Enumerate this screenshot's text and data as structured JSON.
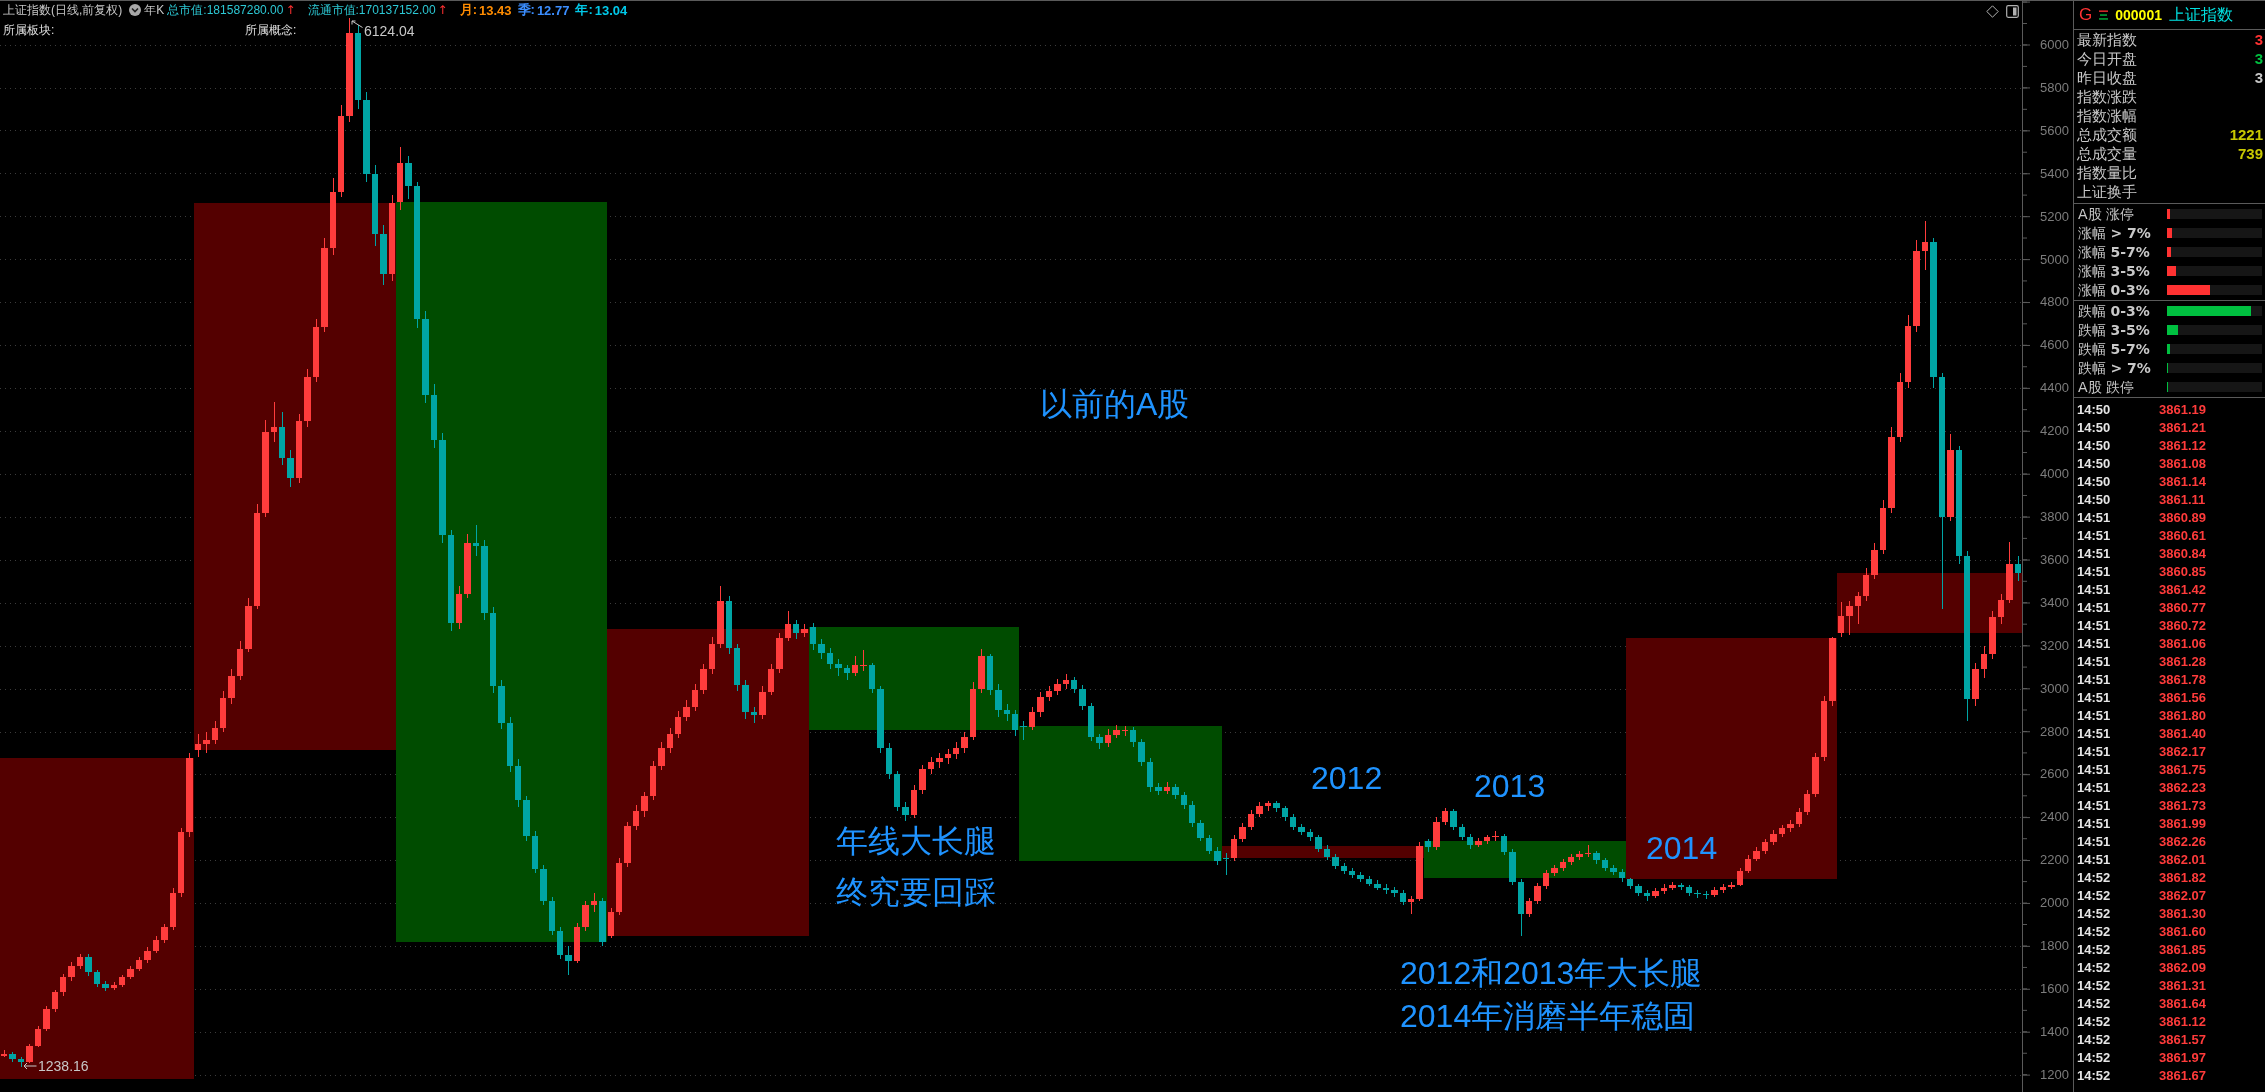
{
  "header": {
    "title": "上证指数(日线,前复权)",
    "period": "年K",
    "caps": [
      {
        "label": "总市值:",
        "value": "181587280.00",
        "arrow": "↑"
      },
      {
        "label": "流通市值:",
        "value": "170137152.00",
        "arrow": "↑"
      }
    ],
    "ratios": [
      {
        "label": "月:",
        "value": "13.43",
        "color": "#ff8c00"
      },
      {
        "label": "季:",
        "value": "12.77",
        "color": "#3b8eff"
      },
      {
        "label": "年:",
        "value": "13.04",
        "color": "#00c8e8"
      }
    ],
    "tags": [
      {
        "label": "所属板块:"
      },
      {
        "label": "所属概念:"
      }
    ]
  },
  "chart": {
    "chart_data": {
      "type": "candlestick",
      "grid": true,
      "ylim": [
        1121,
        6203
      ],
      "yticks": [
        6000,
        5800,
        5600,
        5400,
        5200,
        5000,
        4800,
        4600,
        4400,
        4200,
        4000,
        3800,
        3600,
        3400,
        3200,
        3000,
        2800,
        2600,
        2400,
        2200,
        2000,
        1800,
        1600,
        1400,
        1200
      ],
      "ohlc": [
        [
          1290,
          1315,
          1282,
          1298
        ],
        [
          1298,
          1305,
          1262,
          1275
        ],
        [
          1275,
          1282,
          1238,
          1263
        ],
        [
          1263,
          1345,
          1258,
          1337
        ],
        [
          1337,
          1428,
          1330,
          1415
        ],
        [
          1415,
          1520,
          1405,
          1506
        ],
        [
          1506,
          1598,
          1495,
          1586
        ],
        [
          1586,
          1672,
          1570,
          1656
        ],
        [
          1656,
          1725,
          1640,
          1709
        ],
        [
          1709,
          1765,
          1695,
          1750
        ],
        [
          1750,
          1762,
          1660,
          1678
        ],
        [
          1678,
          1690,
          1612,
          1625
        ],
        [
          1625,
          1640,
          1590,
          1605
        ],
        [
          1605,
          1632,
          1595,
          1620
        ],
        [
          1620,
          1668,
          1610,
          1656
        ],
        [
          1656,
          1708,
          1648,
          1695
        ],
        [
          1695,
          1750,
          1685,
          1735
        ],
        [
          1735,
          1795,
          1722,
          1779
        ],
        [
          1779,
          1848,
          1770,
          1829
        ],
        [
          1829,
          1905,
          1815,
          1888
        ],
        [
          1888,
          2070,
          1875,
          2050
        ],
        [
          2050,
          2350,
          2030,
          2330
        ],
        [
          2330,
          2698,
          2310,
          2675
        ],
        [
          2715,
          2790,
          2680,
          2740
        ],
        [
          2740,
          2800,
          2700,
          2760
        ],
        [
          2760,
          2850,
          2740,
          2818
        ],
        [
          2818,
          2990,
          2800,
          2955
        ],
        [
          2955,
          3090,
          2930,
          3060
        ],
        [
          3060,
          3220,
          3040,
          3186
        ],
        [
          3186,
          3420,
          3170,
          3386
        ],
        [
          3386,
          3860,
          3370,
          3818
        ],
        [
          3818,
          4250,
          3800,
          4196
        ],
        [
          4196,
          4335,
          4150,
          4220
        ],
        [
          4220,
          4290,
          4040,
          4074
        ],
        [
          4074,
          4110,
          3940,
          3981
        ],
        [
          3981,
          4280,
          3960,
          4245
        ],
        [
          4245,
          4490,
          4220,
          4452
        ],
        [
          4452,
          4720,
          4430,
          4686
        ],
        [
          4686,
          5100,
          4660,
          5052
        ],
        [
          5052,
          5380,
          5020,
          5315
        ],
        [
          5315,
          5720,
          5290,
          5669
        ],
        [
          5669,
          6124,
          5640,
          6055
        ],
        [
          6055,
          6090,
          5700,
          5743
        ],
        [
          5743,
          5780,
          5360,
          5396
        ],
        [
          5396,
          5440,
          5060,
          5116
        ],
        [
          5116,
          5160,
          4880,
          4930
        ],
        [
          4930,
          5300,
          4900,
          5262
        ],
        [
          5265,
          5522,
          5230,
          5450
        ],
        [
          5450,
          5480,
          5280,
          5340
        ],
        [
          5340,
          5360,
          4680,
          4720
        ],
        [
          4720,
          4760,
          4330,
          4370
        ],
        [
          4370,
          4420,
          4120,
          4160
        ],
        [
          4160,
          4190,
          3680,
          3715
        ],
        [
          3715,
          3740,
          3270,
          3307
        ],
        [
          3307,
          3480,
          3280,
          3440
        ],
        [
          3440,
          3720,
          3420,
          3680
        ],
        [
          3680,
          3760,
          3620,
          3666
        ],
        [
          3666,
          3690,
          3320,
          3354
        ],
        [
          3354,
          3380,
          2980,
          3010
        ],
        [
          3010,
          3040,
          2810,
          2840
        ],
        [
          2840,
          2870,
          2610,
          2640
        ],
        [
          2640,
          2670,
          2450,
          2480
        ],
        [
          2480,
          2500,
          2290,
          2315
        ],
        [
          2315,
          2335,
          2140,
          2160
        ],
        [
          2160,
          2180,
          1990,
          2010
        ],
        [
          2010,
          2030,
          1850,
          1870
        ],
        [
          1870,
          1890,
          1740,
          1760
        ],
        [
          1760,
          1800,
          1664,
          1730
        ],
        [
          1730,
          1910,
          1720,
          1890
        ],
        [
          1890,
          2010,
          1870,
          1990
        ],
        [
          1990,
          2050,
          1960,
          2010
        ],
        [
          2010,
          2025,
          1800,
          1820
        ],
        [
          1849,
          1980,
          1840,
          1960
        ],
        [
          1960,
          2210,
          1945,
          2190
        ],
        [
          2190,
          2380,
          2170,
          2360
        ],
        [
          2360,
          2460,
          2340,
          2430
        ],
        [
          2430,
          2520,
          2400,
          2500
        ],
        [
          2500,
          2665,
          2480,
          2640
        ],
        [
          2640,
          2750,
          2620,
          2725
        ],
        [
          2725,
          2815,
          2700,
          2790
        ],
        [
          2790,
          2895,
          2770,
          2870
        ],
        [
          2870,
          2945,
          2850,
          2915
        ],
        [
          2915,
          3020,
          2895,
          2995
        ],
        [
          2995,
          3115,
          2975,
          3090
        ],
        [
          3090,
          3240,
          3070,
          3210
        ],
        [
          3210,
          3478,
          3190,
          3410
        ],
        [
          3410,
          3430,
          3160,
          3190
        ],
        [
          3190,
          3210,
          2990,
          3016
        ],
        [
          3016,
          3040,
          2860,
          2890
        ],
        [
          2890,
          2915,
          2840,
          2875
        ],
        [
          2875,
          3010,
          2860,
          2985
        ],
        [
          2985,
          3115,
          2970,
          3090
        ],
        [
          3090,
          3260,
          3075,
          3237
        ],
        [
          3237,
          3361,
          3220,
          3300
        ],
        [
          3300,
          3320,
          3230,
          3260
        ],
        [
          3260,
          3300,
          3240,
          3277
        ],
        [
          3289,
          3306,
          3180,
          3206
        ],
        [
          3206,
          3230,
          3140,
          3165
        ],
        [
          3165,
          3190,
          3090,
          3115
        ],
        [
          3115,
          3140,
          3060,
          3095
        ],
        [
          3095,
          3110,
          3040,
          3075
        ],
        [
          3075,
          3150,
          3060,
          3110
        ],
        [
          3110,
          3181,
          3080,
          3110
        ],
        [
          3110,
          3120,
          2980,
          3000
        ],
        [
          3000,
          3010,
          2700,
          2725
        ],
        [
          2725,
          2745,
          2580,
          2600
        ],
        [
          2600,
          2615,
          2430,
          2450
        ],
        [
          2450,
          2470,
          2385,
          2410
        ],
        [
          2410,
          2550,
          2395,
          2530
        ],
        [
          2530,
          2645,
          2510,
          2625
        ],
        [
          2625,
          2680,
          2600,
          2656
        ],
        [
          2656,
          2700,
          2630,
          2676
        ],
        [
          2676,
          2720,
          2650,
          2695
        ],
        [
          2695,
          2750,
          2670,
          2725
        ],
        [
          2725,
          2800,
          2700,
          2776
        ],
        [
          2776,
          3030,
          2760,
          3000
        ],
        [
          3000,
          3186,
          2980,
          3150
        ],
        [
          3150,
          3160,
          2970,
          2995
        ],
        [
          2995,
          3020,
          2870,
          2900
        ],
        [
          2900,
          2930,
          2850,
          2880
        ],
        [
          2880,
          2900,
          2780,
          2808
        ],
        [
          2825,
          2850,
          2760,
          2820
        ],
        [
          2820,
          2915,
          2805,
          2890
        ],
        [
          2890,
          2985,
          2870,
          2960
        ],
        [
          2960,
          3010,
          2940,
          2990
        ],
        [
          2990,
          3045,
          2970,
          3020
        ],
        [
          3020,
          3067,
          3000,
          3040
        ],
        [
          3040,
          3055,
          2980,
          3000
        ],
        [
          3000,
          3015,
          2900,
          2920
        ],
        [
          2920,
          2935,
          2755,
          2775
        ],
        [
          2775,
          2790,
          2720,
          2745
        ],
        [
          2745,
          2810,
          2730,
          2785
        ],
        [
          2785,
          2830,
          2770,
          2809
        ],
        [
          2809,
          2826,
          2780,
          2809
        ],
        [
          2809,
          2820,
          2730,
          2752
        ],
        [
          2752,
          2765,
          2640,
          2660
        ],
        [
          2660,
          2675,
          2520,
          2540
        ],
        [
          2540,
          2560,
          2505,
          2525
        ],
        [
          2525,
          2565,
          2510,
          2540
        ],
        [
          2540,
          2555,
          2485,
          2505
        ],
        [
          2505,
          2520,
          2440,
          2460
        ],
        [
          2460,
          2475,
          2355,
          2375
        ],
        [
          2375,
          2390,
          2290,
          2305
        ],
        [
          2305,
          2320,
          2230,
          2245
        ],
        [
          2245,
          2260,
          2180,
          2199
        ],
        [
          2212,
          2235,
          2132,
          2210
        ],
        [
          2210,
          2320,
          2195,
          2300
        ],
        [
          2300,
          2375,
          2285,
          2355
        ],
        [
          2355,
          2435,
          2340,
          2414
        ],
        [
          2414,
          2470,
          2400,
          2453
        ],
        [
          2453,
          2478,
          2430,
          2466
        ],
        [
          2466,
          2475,
          2425,
          2445
        ],
        [
          2445,
          2455,
          2385,
          2403
        ],
        [
          2403,
          2415,
          2340,
          2357
        ],
        [
          2357,
          2370,
          2320,
          2333
        ],
        [
          2333,
          2345,
          2290,
          2307
        ],
        [
          2307,
          2320,
          2240,
          2255
        ],
        [
          2255,
          2270,
          2200,
          2215
        ],
        [
          2215,
          2230,
          2160,
          2175
        ],
        [
          2175,
          2190,
          2135,
          2150
        ],
        [
          2150,
          2165,
          2120,
          2133
        ],
        [
          2133,
          2148,
          2100,
          2113
        ],
        [
          2113,
          2128,
          2080,
          2092
        ],
        [
          2092,
          2108,
          2060,
          2073
        ],
        [
          2073,
          2090,
          2045,
          2060
        ],
        [
          2060,
          2075,
          2030,
          2047
        ],
        [
          2047,
          2060,
          1990,
          2005
        ],
        [
          2005,
          2035,
          1949,
          2020
        ],
        [
          2020,
          2285,
          2010,
          2269
        ],
        [
          2289,
          2300,
          2240,
          2260
        ],
        [
          2260,
          2400,
          2250,
          2380
        ],
        [
          2380,
          2444,
          2365,
          2430
        ],
        [
          2430,
          2440,
          2340,
          2355
        ],
        [
          2355,
          2370,
          2295,
          2311
        ],
        [
          2311,
          2325,
          2255,
          2272
        ],
        [
          2272,
          2305,
          2260,
          2290
        ],
        [
          2290,
          2320,
          2275,
          2307
        ],
        [
          2307,
          2335,
          2290,
          2315
        ],
        [
          2315,
          2325,
          2225,
          2240
        ],
        [
          2240,
          2255,
          2085,
          2100
        ],
        [
          2100,
          2115,
          1849,
          1950
        ],
        [
          1950,
          2025,
          1935,
          2010
        ],
        [
          2010,
          2095,
          1995,
          2080
        ],
        [
          2080,
          2155,
          2065,
          2140
        ],
        [
          2140,
          2180,
          2125,
          2166
        ],
        [
          2166,
          2205,
          2150,
          2192
        ],
        [
          2192,
          2230,
          2180,
          2215
        ],
        [
          2215,
          2245,
          2200,
          2230
        ],
        [
          2230,
          2270,
          2215,
          2236
        ],
        [
          2236,
          2245,
          2185,
          2200
        ],
        [
          2200,
          2212,
          2150,
          2165
        ],
        [
          2165,
          2178,
          2132,
          2147
        ],
        [
          2147,
          2160,
          2100,
          2116
        ],
        [
          2112,
          2120,
          2065,
          2080
        ],
        [
          2080,
          2092,
          2035,
          2050
        ],
        [
          2050,
          2060,
          2010,
          2036
        ],
        [
          2036,
          2070,
          2025,
          2056
        ],
        [
          2056,
          2090,
          2045,
          2073
        ],
        [
          2073,
          2100,
          2060,
          2086
        ],
        [
          2086,
          2095,
          2060,
          2075
        ],
        [
          2075,
          2085,
          2035,
          2050
        ],
        [
          2050,
          2060,
          2025,
          2042
        ],
        [
          2042,
          2055,
          2020,
          2040
        ],
        [
          2040,
          2075,
          2030,
          2060
        ],
        [
          2060,
          2090,
          2050,
          2075
        ],
        [
          2075,
          2100,
          2065,
          2087
        ],
        [
          2087,
          2165,
          2080,
          2150
        ],
        [
          2150,
          2225,
          2140,
          2208
        ],
        [
          2208,
          2260,
          2195,
          2245
        ],
        [
          2245,
          2300,
          2230,
          2285
        ],
        [
          2285,
          2340,
          2270,
          2325
        ],
        [
          2325,
          2365,
          2310,
          2350
        ],
        [
          2350,
          2390,
          2330,
          2370
        ],
        [
          2370,
          2445,
          2355,
          2427
        ],
        [
          2427,
          2530,
          2410,
          2510
        ],
        [
          2510,
          2700,
          2495,
          2680
        ],
        [
          2680,
          2965,
          2665,
          2940
        ],
        [
          2940,
          3240,
          2920,
          3235
        ],
        [
          3258,
          3405,
          3240,
          3340
        ],
        [
          3340,
          3406,
          3250,
          3383
        ],
        [
          3383,
          3450,
          3300,
          3430
        ],
        [
          3430,
          3560,
          3410,
          3530
        ],
        [
          3530,
          3680,
          3510,
          3645
        ],
        [
          3645,
          3880,
          3625,
          3840
        ],
        [
          3840,
          4220,
          3820,
          4170
        ],
        [
          4170,
          4470,
          4150,
          4430
        ],
        [
          4430,
          4740,
          4400,
          4690
        ],
        [
          4690,
          5090,
          4660,
          5040
        ],
        [
          5040,
          5178,
          4950,
          5080
        ],
        [
          5080,
          5100,
          4400,
          4450
        ],
        [
          4450,
          4470,
          3373,
          3800
        ],
        [
          3800,
          4185,
          3780,
          4110
        ],
        [
          4110,
          4130,
          3580,
          3620
        ],
        [
          3620,
          3640,
          2850,
          2950
        ],
        [
          2950,
          3120,
          2920,
          3090
        ],
        [
          3090,
          3200,
          3050,
          3160
        ],
        [
          3160,
          3360,
          3140,
          3335
        ],
        [
          3335,
          3440,
          3300,
          3415
        ],
        [
          3415,
          3684,
          3400,
          3580
        ],
        [
          3580,
          3620,
          3500,
          3539
        ]
      ]
    },
    "high_label": "6124.04",
    "low_label": "1238.16",
    "notes": [
      {
        "lines": [
          "以前的A股"
        ]
      },
      {
        "lines": [
          "2012"
        ]
      },
      {
        "lines": [
          "2013"
        ]
      },
      {
        "lines": [
          "年线大长腿",
          "终究要回踩"
        ]
      },
      {
        "lines": [
          "2014"
        ]
      },
      {
        "lines": [
          "2012和2013年大长腿",
          "2014年消磨半年稳固"
        ]
      }
    ]
  },
  "quote": {
    "badge": "G",
    "code": "000001",
    "name": "上证指数",
    "rows": [
      {
        "label": "最新指数",
        "value": "3",
        "color": "#ff3232"
      },
      {
        "label": "今日开盘",
        "value": "3",
        "color": "#00c040"
      },
      {
        "label": "昨日收盘",
        "value": "3",
        "color": "#c8c8c8"
      },
      {
        "label": "指数涨跌"
      },
      {
        "label": "指数涨幅"
      },
      {
        "label": "总成交额",
        "value": "1221",
        "color": "#c8c800"
      },
      {
        "label": "总成交量",
        "value": "739",
        "color": "#c8c800"
      },
      {
        "label": "指数量比"
      },
      {
        "label": "上证换手"
      }
    ]
  },
  "breadth": [
    {
      "kind": "up",
      "rows": [
        {
          "label": "A股 涨停",
          "level": 0.03
        },
        {
          "label": "涨幅 **> 7%**",
          "level": 0.05
        },
        {
          "label": "涨幅 **5-7%**",
          "level": 0.04
        },
        {
          "label": "涨幅 **3-5%**",
          "level": 0.09
        },
        {
          "label": "涨幅 **0-3%**",
          "level": 0.45
        }
      ]
    },
    {
      "kind": "down",
      "rows": [
        {
          "label": "跌幅 **0-3%**",
          "level": 0.88
        },
        {
          "label": "跌幅 **3-5%**",
          "level": 0.12
        },
        {
          "label": "跌幅 **5-7%**",
          "level": 0.03
        },
        {
          "label": "跌幅 **> 7%**",
          "level": 0.01
        },
        {
          "label": "A股 跌停",
          "level": 0.01
        }
      ]
    }
  ],
  "trades": [
    {
      "time": "14:50",
      "price": "3861.19"
    },
    {
      "time": "14:50",
      "price": "3861.21"
    },
    {
      "time": "14:50",
      "price": "3861.12"
    },
    {
      "time": "14:50",
      "price": "3861.08"
    },
    {
      "time": "14:50",
      "price": "3861.14"
    },
    {
      "time": "14:50",
      "price": "3861.11"
    },
    {
      "time": "14:51",
      "price": "3860.89"
    },
    {
      "time": "14:51",
      "price": "3860.61"
    },
    {
      "time": "14:51",
      "price": "3860.84"
    },
    {
      "time": "14:51",
      "price": "3860.85"
    },
    {
      "time": "14:51",
      "price": "3861.42"
    },
    {
      "time": "14:51",
      "price": "3860.77"
    },
    {
      "time": "14:51",
      "price": "3860.72"
    },
    {
      "time": "14:51",
      "price": "3861.06"
    },
    {
      "time": "14:51",
      "price": "3861.28"
    },
    {
      "time": "14:51",
      "price": "3861.78"
    },
    {
      "time": "14:51",
      "price": "3861.56"
    },
    {
      "time": "14:51",
      "price": "3861.80"
    },
    {
      "time": "14:51",
      "price": "3861.40"
    },
    {
      "time": "14:51",
      "price": "3862.17"
    },
    {
      "time": "14:51",
      "price": "3861.75"
    },
    {
      "time": "14:51",
      "price": "3862.23"
    },
    {
      "time": "14:51",
      "price": "3861.73"
    },
    {
      "time": "14:51",
      "price": "3861.99"
    },
    {
      "time": "14:51",
      "price": "3862.26"
    },
    {
      "time": "14:51",
      "price": "3862.01"
    },
    {
      "time": "14:52",
      "price": "3861.82"
    },
    {
      "time": "14:52",
      "price": "3862.07"
    },
    {
      "time": "14:52",
      "price": "3861.30"
    },
    {
      "time": "14:52",
      "price": "3861.60"
    },
    {
      "time": "14:52",
      "price": "3861.85"
    },
    {
      "time": "14:52",
      "price": "3862.09"
    },
    {
      "time": "14:52",
      "price": "3861.31"
    },
    {
      "time": "14:52",
      "price": "3861.64"
    },
    {
      "time": "14:52",
      "price": "3861.12"
    },
    {
      "time": "14:52",
      "price": "3861.57"
    },
    {
      "time": "14:52",
      "price": "3861.97"
    },
    {
      "time": "14:52",
      "price": "3861.67"
    }
  ]
}
